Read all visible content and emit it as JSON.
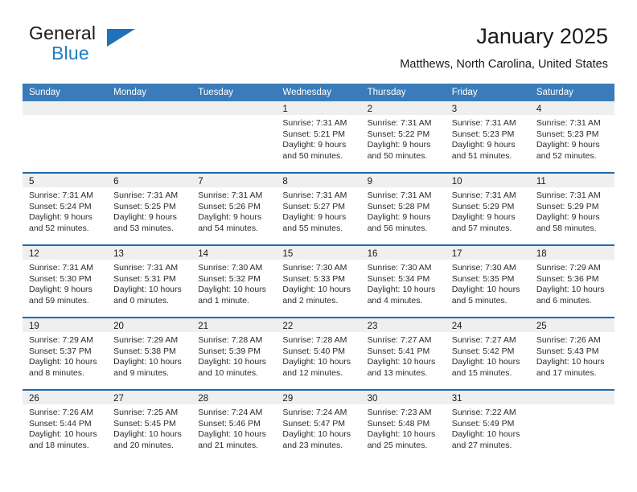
{
  "brand": {
    "name_part1": "General",
    "name_part2": "Blue",
    "accent_color": "#1f72b8"
  },
  "header": {
    "title": "January 2025",
    "subtitle": "Matthews, North Carolina, United States"
  },
  "calendar": {
    "header_bg": "#3a7cba",
    "weekdays": [
      "Sunday",
      "Monday",
      "Tuesday",
      "Wednesday",
      "Thursday",
      "Friday",
      "Saturday"
    ],
    "weeks": [
      [
        {
          "day": "",
          "sunrise": "",
          "sunset": "",
          "daylight": ""
        },
        {
          "day": "",
          "sunrise": "",
          "sunset": "",
          "daylight": ""
        },
        {
          "day": "",
          "sunrise": "",
          "sunset": "",
          "daylight": ""
        },
        {
          "day": "1",
          "sunrise": "Sunrise: 7:31 AM",
          "sunset": "Sunset: 5:21 PM",
          "daylight": "Daylight: 9 hours and 50 minutes."
        },
        {
          "day": "2",
          "sunrise": "Sunrise: 7:31 AM",
          "sunset": "Sunset: 5:22 PM",
          "daylight": "Daylight: 9 hours and 50 minutes."
        },
        {
          "day": "3",
          "sunrise": "Sunrise: 7:31 AM",
          "sunset": "Sunset: 5:23 PM",
          "daylight": "Daylight: 9 hours and 51 minutes."
        },
        {
          "day": "4",
          "sunrise": "Sunrise: 7:31 AM",
          "sunset": "Sunset: 5:23 PM",
          "daylight": "Daylight: 9 hours and 52 minutes."
        }
      ],
      [
        {
          "day": "5",
          "sunrise": "Sunrise: 7:31 AM",
          "sunset": "Sunset: 5:24 PM",
          "daylight": "Daylight: 9 hours and 52 minutes."
        },
        {
          "day": "6",
          "sunrise": "Sunrise: 7:31 AM",
          "sunset": "Sunset: 5:25 PM",
          "daylight": "Daylight: 9 hours and 53 minutes."
        },
        {
          "day": "7",
          "sunrise": "Sunrise: 7:31 AM",
          "sunset": "Sunset: 5:26 PM",
          "daylight": "Daylight: 9 hours and 54 minutes."
        },
        {
          "day": "8",
          "sunrise": "Sunrise: 7:31 AM",
          "sunset": "Sunset: 5:27 PM",
          "daylight": "Daylight: 9 hours and 55 minutes."
        },
        {
          "day": "9",
          "sunrise": "Sunrise: 7:31 AM",
          "sunset": "Sunset: 5:28 PM",
          "daylight": "Daylight: 9 hours and 56 minutes."
        },
        {
          "day": "10",
          "sunrise": "Sunrise: 7:31 AM",
          "sunset": "Sunset: 5:29 PM",
          "daylight": "Daylight: 9 hours and 57 minutes."
        },
        {
          "day": "11",
          "sunrise": "Sunrise: 7:31 AM",
          "sunset": "Sunset: 5:29 PM",
          "daylight": "Daylight: 9 hours and 58 minutes."
        }
      ],
      [
        {
          "day": "12",
          "sunrise": "Sunrise: 7:31 AM",
          "sunset": "Sunset: 5:30 PM",
          "daylight": "Daylight: 9 hours and 59 minutes."
        },
        {
          "day": "13",
          "sunrise": "Sunrise: 7:31 AM",
          "sunset": "Sunset: 5:31 PM",
          "daylight": "Daylight: 10 hours and 0 minutes."
        },
        {
          "day": "14",
          "sunrise": "Sunrise: 7:30 AM",
          "sunset": "Sunset: 5:32 PM",
          "daylight": "Daylight: 10 hours and 1 minute."
        },
        {
          "day": "15",
          "sunrise": "Sunrise: 7:30 AM",
          "sunset": "Sunset: 5:33 PM",
          "daylight": "Daylight: 10 hours and 2 minutes."
        },
        {
          "day": "16",
          "sunrise": "Sunrise: 7:30 AM",
          "sunset": "Sunset: 5:34 PM",
          "daylight": "Daylight: 10 hours and 4 minutes."
        },
        {
          "day": "17",
          "sunrise": "Sunrise: 7:30 AM",
          "sunset": "Sunset: 5:35 PM",
          "daylight": "Daylight: 10 hours and 5 minutes."
        },
        {
          "day": "18",
          "sunrise": "Sunrise: 7:29 AM",
          "sunset": "Sunset: 5:36 PM",
          "daylight": "Daylight: 10 hours and 6 minutes."
        }
      ],
      [
        {
          "day": "19",
          "sunrise": "Sunrise: 7:29 AM",
          "sunset": "Sunset: 5:37 PM",
          "daylight": "Daylight: 10 hours and 8 minutes."
        },
        {
          "day": "20",
          "sunrise": "Sunrise: 7:29 AM",
          "sunset": "Sunset: 5:38 PM",
          "daylight": "Daylight: 10 hours and 9 minutes."
        },
        {
          "day": "21",
          "sunrise": "Sunrise: 7:28 AM",
          "sunset": "Sunset: 5:39 PM",
          "daylight": "Daylight: 10 hours and 10 minutes."
        },
        {
          "day": "22",
          "sunrise": "Sunrise: 7:28 AM",
          "sunset": "Sunset: 5:40 PM",
          "daylight": "Daylight: 10 hours and 12 minutes."
        },
        {
          "day": "23",
          "sunrise": "Sunrise: 7:27 AM",
          "sunset": "Sunset: 5:41 PM",
          "daylight": "Daylight: 10 hours and 13 minutes."
        },
        {
          "day": "24",
          "sunrise": "Sunrise: 7:27 AM",
          "sunset": "Sunset: 5:42 PM",
          "daylight": "Daylight: 10 hours and 15 minutes."
        },
        {
          "day": "25",
          "sunrise": "Sunrise: 7:26 AM",
          "sunset": "Sunset: 5:43 PM",
          "daylight": "Daylight: 10 hours and 17 minutes."
        }
      ],
      [
        {
          "day": "26",
          "sunrise": "Sunrise: 7:26 AM",
          "sunset": "Sunset: 5:44 PM",
          "daylight": "Daylight: 10 hours and 18 minutes."
        },
        {
          "day": "27",
          "sunrise": "Sunrise: 7:25 AM",
          "sunset": "Sunset: 5:45 PM",
          "daylight": "Daylight: 10 hours and 20 minutes."
        },
        {
          "day": "28",
          "sunrise": "Sunrise: 7:24 AM",
          "sunset": "Sunset: 5:46 PM",
          "daylight": "Daylight: 10 hours and 21 minutes."
        },
        {
          "day": "29",
          "sunrise": "Sunrise: 7:24 AM",
          "sunset": "Sunset: 5:47 PM",
          "daylight": "Daylight: 10 hours and 23 minutes."
        },
        {
          "day": "30",
          "sunrise": "Sunrise: 7:23 AM",
          "sunset": "Sunset: 5:48 PM",
          "daylight": "Daylight: 10 hours and 25 minutes."
        },
        {
          "day": "31",
          "sunrise": "Sunrise: 7:22 AM",
          "sunset": "Sunset: 5:49 PM",
          "daylight": "Daylight: 10 hours and 27 minutes."
        },
        {
          "day": "",
          "sunrise": "",
          "sunset": "",
          "daylight": ""
        }
      ]
    ]
  }
}
